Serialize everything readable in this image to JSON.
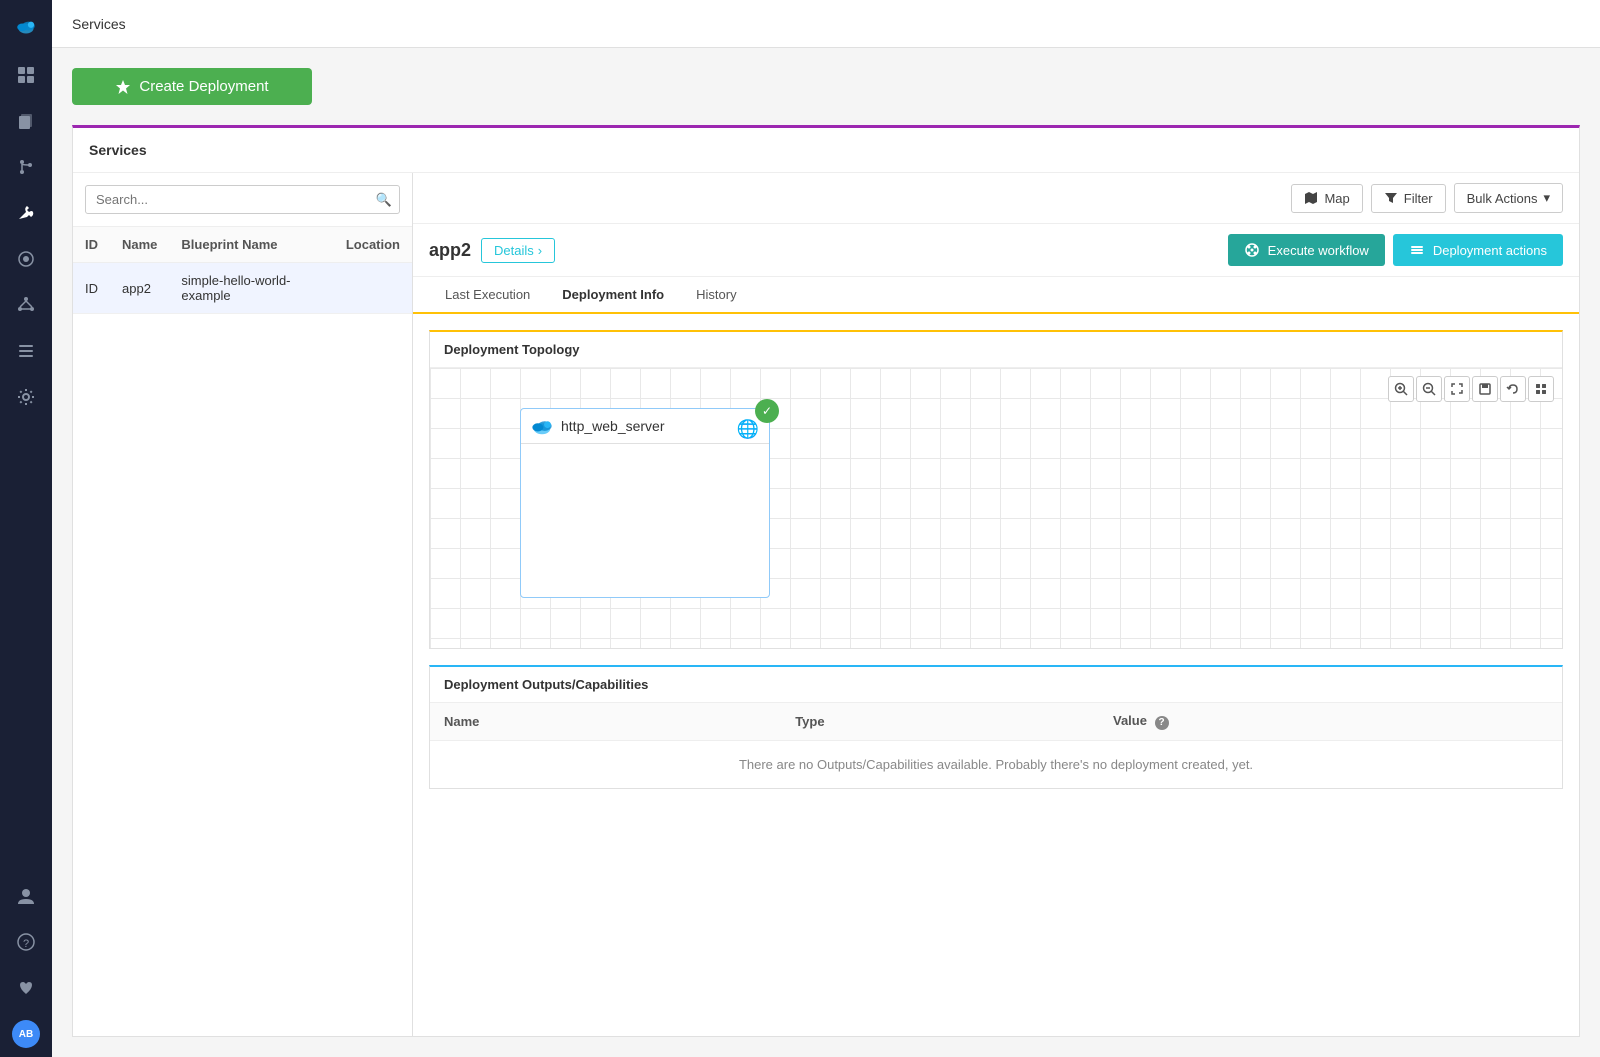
{
  "sidebar": {
    "logo": "☁",
    "items": [
      {
        "name": "dashboard-icon",
        "icon": "⊞",
        "active": false
      },
      {
        "name": "copies-icon",
        "icon": "⧉",
        "active": false
      },
      {
        "name": "git-icon",
        "icon": "⌥",
        "active": false
      },
      {
        "name": "tools-icon",
        "icon": "🔧",
        "active": true
      },
      {
        "name": "settings-circle-icon",
        "icon": "⊙",
        "active": false
      },
      {
        "name": "nodes-icon",
        "icon": "⬡",
        "active": false
      },
      {
        "name": "list-icon",
        "icon": "≡",
        "active": false
      },
      {
        "name": "gear-icon",
        "icon": "⚙",
        "active": false
      }
    ],
    "bottom": [
      {
        "name": "user-icon",
        "icon": "👤"
      },
      {
        "name": "help-icon",
        "icon": "?"
      },
      {
        "name": "heart-icon",
        "icon": "♥"
      }
    ],
    "avatar": {
      "initials": "AB",
      "color": "#3d8af7"
    }
  },
  "topbar": {
    "title": "Services"
  },
  "create_btn": {
    "label": "Create Deployment",
    "icon": "🚀"
  },
  "services_panel": {
    "title": "Services"
  },
  "toolbar": {
    "search_placeholder": "Search...",
    "map_label": "Map",
    "filter_label": "Filter",
    "bulk_actions_label": "Bulk Actions"
  },
  "table": {
    "columns": [
      "ID",
      "Name",
      "Blueprint Name",
      "Location"
    ],
    "rows": [
      {
        "id": "ID",
        "name": "app2",
        "blueprint": "simple-hello-world-example",
        "location": ""
      }
    ]
  },
  "app": {
    "name": "app2",
    "details_btn": "Details",
    "execute_btn": "Execute workflow",
    "deploy_actions_btn": "Deployment actions"
  },
  "tabs": [
    {
      "label": "Last Execution",
      "active": false
    },
    {
      "label": "Deployment Info",
      "active": true
    },
    {
      "label": "History",
      "active": false
    }
  ],
  "topology": {
    "title": "Deployment Topology",
    "node": {
      "name": "http_web_server",
      "status": "✓"
    },
    "controls": [
      "🔍+",
      "🔍-",
      "⤢",
      "⊡",
      "↩",
      "⊞"
    ]
  },
  "outputs": {
    "title": "Deployment Outputs/Capabilities",
    "columns": [
      "Name",
      "Type",
      "Value"
    ],
    "empty_message": "There are no Outputs/Capabilities available. Probably there's no deployment created, yet."
  }
}
